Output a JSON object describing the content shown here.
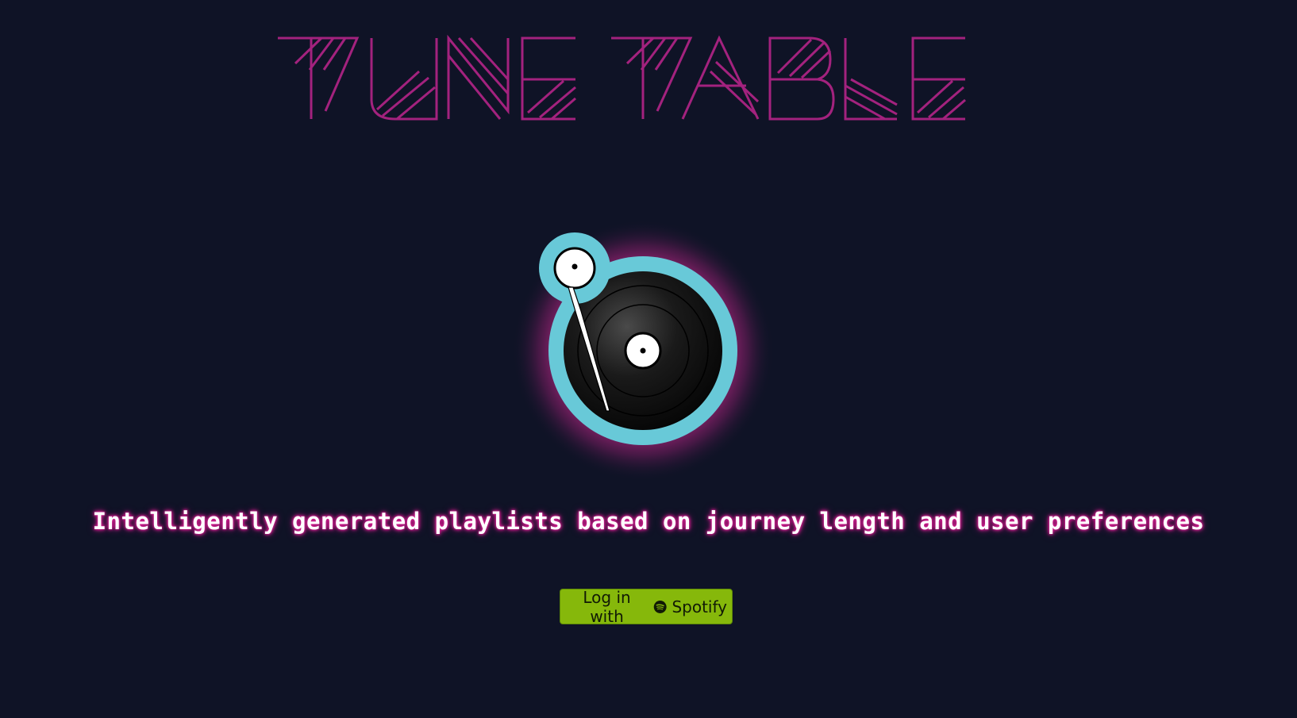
{
  "app": {
    "logo_text": "TUNE TABLE",
    "logo_color": "#a3227e",
    "background_color": "#0f1326"
  },
  "hero": {
    "icon": "turntable-icon",
    "ring_color": "#68c9d8",
    "glow_color": "#c72a8e"
  },
  "tagline": {
    "text": "Intelligently generated playlists based on journey length and user preferences"
  },
  "login": {
    "prefix": "Log in with",
    "brand": "Spotify",
    "icon": "spotify-icon",
    "button_color": "#86b80b"
  }
}
